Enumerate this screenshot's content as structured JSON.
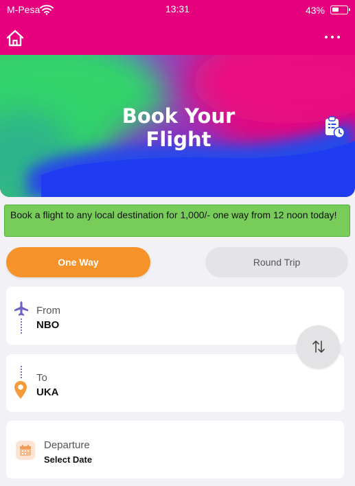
{
  "status_bar": {
    "carrier": "M-Pesa",
    "time": "13:31",
    "battery": "43%"
  },
  "app_bar": {
    "home_icon": "home-icon",
    "menu_icon": "more-horizontal-icon"
  },
  "hero": {
    "title_line1": "Book Your",
    "title_line2": "Flight",
    "history_icon": "booking-history-icon"
  },
  "promo": {
    "text": "Book a flight to any local destination for 1,000/- one way from 12 noon today!"
  },
  "trip_type": {
    "one_way": "One Way",
    "round_trip": "Round Trip",
    "selected": "One Way"
  },
  "from": {
    "label": "From",
    "value": "NBO"
  },
  "to": {
    "label": "To",
    "value": "UKA"
  },
  "departure": {
    "label": "Departure",
    "value": "Select Date"
  },
  "colors": {
    "brand": "#e6007e",
    "accent": "#f5922a",
    "promo_bg": "#78cd5a",
    "page_bg": "#f2f1f6"
  }
}
